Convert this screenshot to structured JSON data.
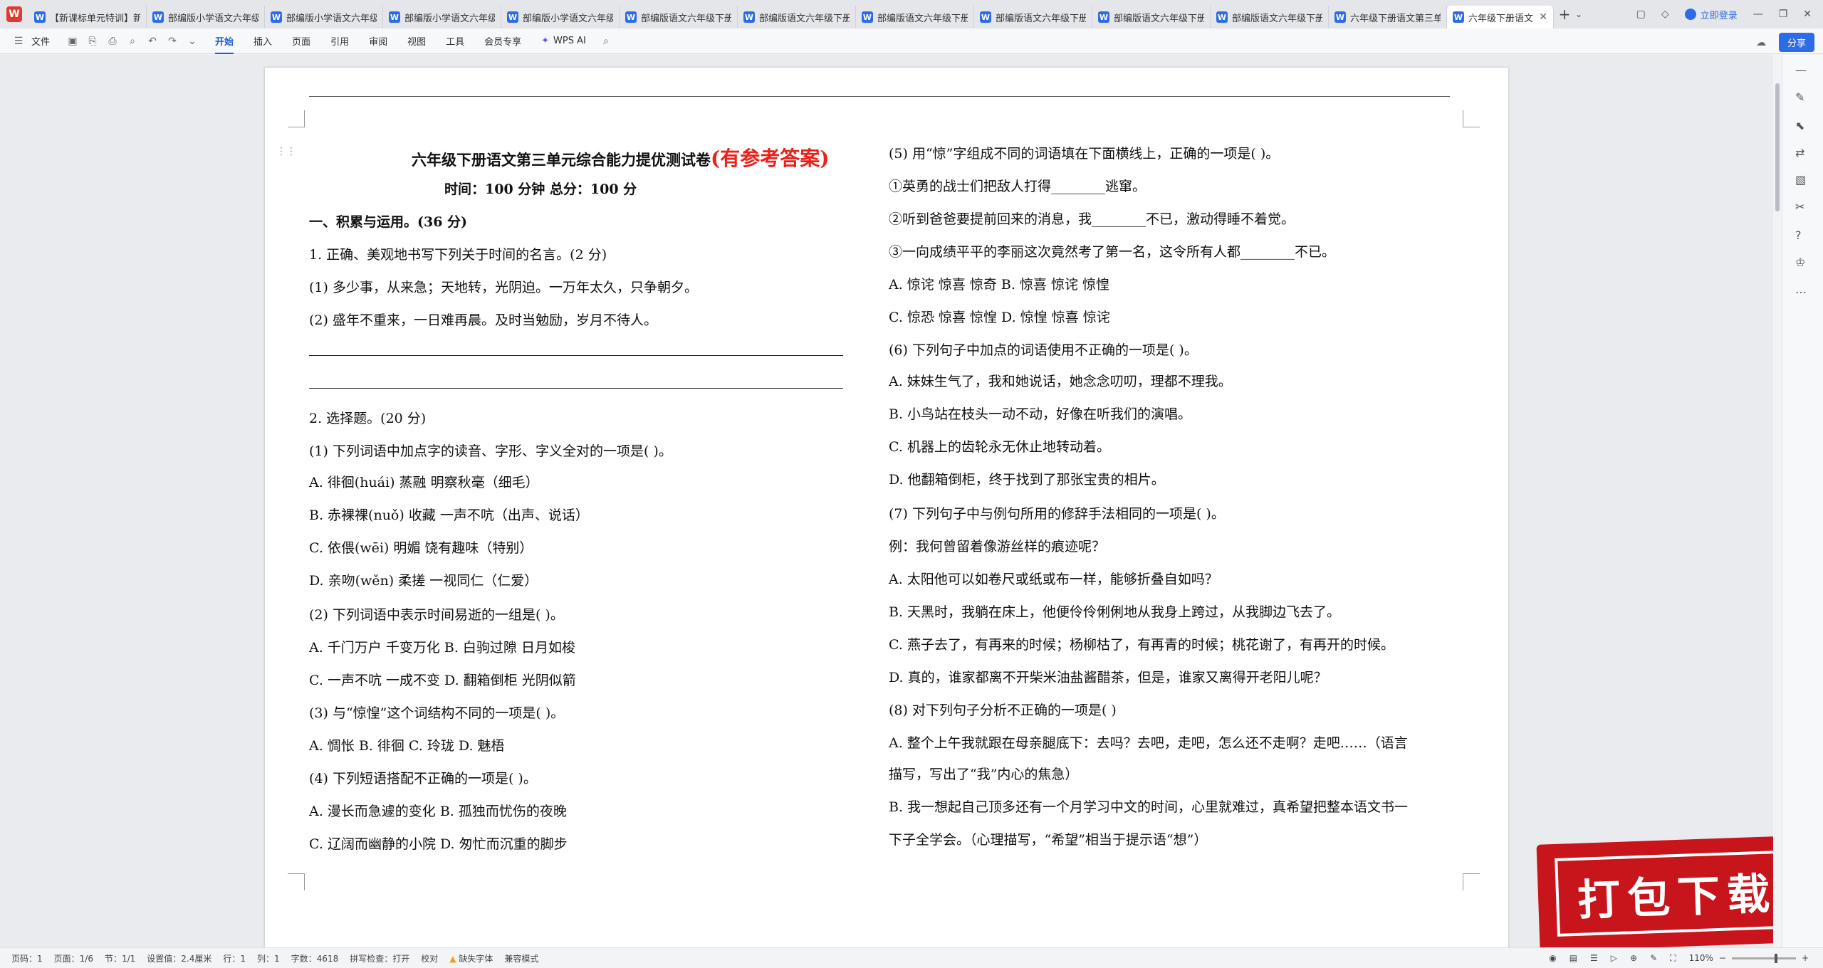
{
  "tabs": [
    {
      "label": "【新课标单元特训】新"
    },
    {
      "label": "部编版小学语文六年级"
    },
    {
      "label": "部编版小学语文六年级"
    },
    {
      "label": "部编版小学语文六年级"
    },
    {
      "label": "部编版小学语文六年级"
    },
    {
      "label": "部编版语文六年级下册"
    },
    {
      "label": "部编版语文六年级下册"
    },
    {
      "label": "部编版语文六年级下册"
    },
    {
      "label": "部编版语文六年级下册"
    },
    {
      "label": "部编版语文六年级下册"
    },
    {
      "label": "部编版语文六年级下册"
    },
    {
      "label": "六年级下册语文第三单"
    },
    {
      "label": "六年级下册语文"
    }
  ],
  "tabbar": {
    "login": "立即登录"
  },
  "menu": {
    "file": "文件",
    "items": [
      "开始",
      "插入",
      "页面",
      "引用",
      "审阅",
      "视图",
      "工具",
      "会员专享"
    ],
    "ai": "WPS AI",
    "share": "分享"
  },
  "doc": {
    "title": "六年级下册语文第三单元综合能力提优测试卷",
    "title_red": "(有参考答案)",
    "subtitle": "时间：100 分钟    总分：100 分",
    "left": [
      "一、积累与运用。(36 分)",
      "1. 正确、美观地书写下列关于时间的名言。(2 分)",
      "(1) 多少事，从来急；天地转，光阴迫。一万年太久，只争朝夕。",
      "(2) 盛年不重来，一日难再晨。及时当勉励，岁月不待人。",
      "2. 选择题。(20 分)",
      "(1) 下列词语中加点字的读音、字形、字义全对的一项是(        )。",
      "A. 徘徊(huái)        蒸融        明察秋毫（细毛）",
      "B. 赤裸裸(nuǒ)        收藏        一声不吭（出声、说话）",
      "C. 依偎(wēi)        明媚        饶有趣味（特别）",
      "D. 亲吻(wěn)        柔搓        一视同仁（仁爱）",
      "(2) 下列词语中表示时间易逝的一组是(        )。",
      "A. 千门万户     千变万化                B. 白驹过隙      日月如梭",
      "C. 一声不吭     一成不变                D. 翻箱倒柜      光阴似箭",
      "(3) 与“惊惶”这个词结构不同的一项是(        )。",
      "A. 惆怅          B. 徘徊           C. 玲珑           D. 魅梧",
      "(4) 下列短语搭配不正确的一项是(        )。",
      "A. 漫长而急遽的变化              B. 孤独而忧伤的夜晚",
      "C. 辽阔而幽静的小院              D. 匆忙而沉重的脚步"
    ],
    "right": [
      "(5) 用“惊”字组成不同的词语填在下面横线上，正确的一项是(        )。",
      "①英勇的战士们把敌人打得________逃窜。",
      "②听到爸爸要提前回来的消息，我________不已，激动得睡不着觉。",
      "③一向成绩平平的李丽这次竟然考了第一名，这令所有人都________不已。",
      "A. 惊诧    惊喜    惊奇             B. 惊喜    惊诧    惊惶",
      "C. 惊恐    惊喜    惊惶             D. 惊惶    惊喜    惊诧",
      "(6) 下列句子中加点的词语使用不正确的一项是(        )。",
      "A. 妹妹生气了，我和她说话，她念念叨叨，理都不理我。",
      "B. 小鸟站在枝头一动不动，好像在听我们的演唱。",
      "C. 机器上的齿轮永无休止地转动着。",
      "D. 他翻箱倒柜，终于找到了那张宝贵的相片。",
      "(7) 下列句子中与例句所用的修辞手法相同的一项是(        )。",
      "例：我何曾留着像游丝样的痕迹呢？",
      "A. 太阳他可以如卷尺或纸或布一样，能够折叠自如吗？",
      "B. 天黑时，我躺在床上，他便伶伶俐俐地从我身上跨过，从我脚边飞去了。",
      "C. 燕子去了，有再来的时候；杨柳枯了，有再青的时候；桃花谢了，有再开的时候。",
      "D. 真的，谁家都离不开柴米油盐酱醋茶，但是，谁家又离得开老阳儿呢？",
      "(8) 对下列句子分析不正确的一项是(        )",
      "A. 整个上午我就跟在母亲腿底下：去吗？去吧，走吧，怎么还不走啊？走吧……（语言",
      "描写，写出了“我”内心的焦急）",
      "B. 我一想起自己顶多还有一个月学习中文的时间，心里就难过，真希望把整本语文书一",
      "下子全学会。（心理描写，“希望”相当于提示语“想”）"
    ]
  },
  "stamp": "打包下载",
  "status": {
    "page": "页码：1",
    "pages": "页面：1/6",
    "section": "节：1/1",
    "setting": "设置值：2.4厘米",
    "row": "行：1",
    "col": "列：1",
    "words": "字数：4618",
    "spell": "拼写检查：打开",
    "proof": "校对",
    "font": "缺失字体",
    "compat": "兼容模式",
    "zoom": "110%"
  }
}
